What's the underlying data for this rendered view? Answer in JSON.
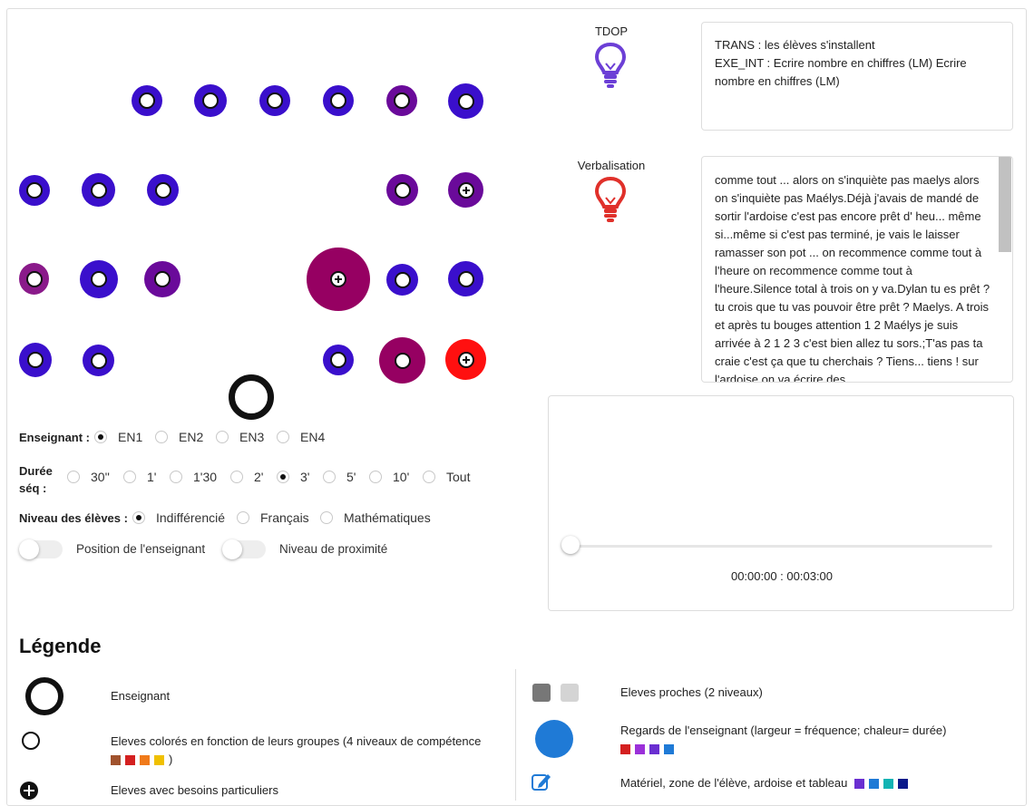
{
  "indicators": {
    "tdop": {
      "label": "TDOP",
      "color": "#6c3fd6"
    },
    "verbalisation": {
      "label": "Verbalisation",
      "color": "#e0302a"
    }
  },
  "activity_box": {
    "line1": "TRANS : les élèves s'installent",
    "line2": "EXE_INT : Ecrire nombre en chiffres (LM) Ecrire nombre en chiffres (LM)"
  },
  "transcript": {
    "text": "comme tout ... alors on s'inquiète pas maelys alors on s'inquiète pas Maélys.Déjà j'avais de mandé de sortir l'ardoise c'est pas encore prêt d' heu... même si...même si c'est pas terminé, je vais le laisser ramasser son pot ... on recommence comme tout à l'heure on recommence comme tout à l'heure.Silence total à trois on y va.Dylan tu es prêt ? tu crois que tu vas pouvoir être prêt ? Maelys. A trois et après tu bouges attention 1 2 Maélys je suis arrivée à 2 1 2 3 c'est bien allez tu sors.;T'as pas ta craie c'est ça que tu cherchais ? Tiens... tiens ! sur l'ardoise on va écrire des"
  },
  "controls": {
    "teacher_label": "Enseignant :",
    "teacher_options": [
      "EN1",
      "EN2",
      "EN3",
      "EN4"
    ],
    "teacher_selected": "EN1",
    "duration_label_1": "Durée",
    "duration_label_2": "séq :",
    "duration_options": [
      "30''",
      "1'",
      "1'30",
      "2'",
      "3'",
      "5'",
      "10'",
      "Tout"
    ],
    "duration_selected": "3'",
    "level_label": "Niveau des élèves :",
    "level_options": [
      "Indifférencié",
      "Français",
      "Mathématiques"
    ],
    "level_selected": "Indifférencié",
    "toggle_position": "Position de l'enseignant",
    "toggle_proximity": "Niveau de proximité"
  },
  "player": {
    "time": "00:00:00 : 00:03:00",
    "progress": 0
  },
  "legend": {
    "title": "Légende",
    "teacher": "Enseignant",
    "students_colored": "Eleves colorés en fonction de leurs groupes (4 niveaux de compétence",
    "students_colored_end": ")",
    "students_special": "Eleves avec besoins particuliers",
    "close_students": "Eleves proches (2 niveaux)",
    "gaze": "Regards de l'enseignant (largeur = fréquence; chaleur= durée)",
    "material": "Matériel, zone de l'élève, ardoise et tableau",
    "competence_colors": [
      "#a0522d",
      "#d42020",
      "#f07a1a",
      "#f0c000"
    ],
    "close_colors": [
      "#777777",
      "#d4d4d4"
    ],
    "gaze_colors": [
      "#d42020",
      "#9b30d9",
      "#6a2fd1",
      "#1f7ad6"
    ],
    "material_colors": [
      "#6a2fd1",
      "#1f7ad6",
      "#12b3b3",
      "#0a1a8a"
    ]
  }
}
